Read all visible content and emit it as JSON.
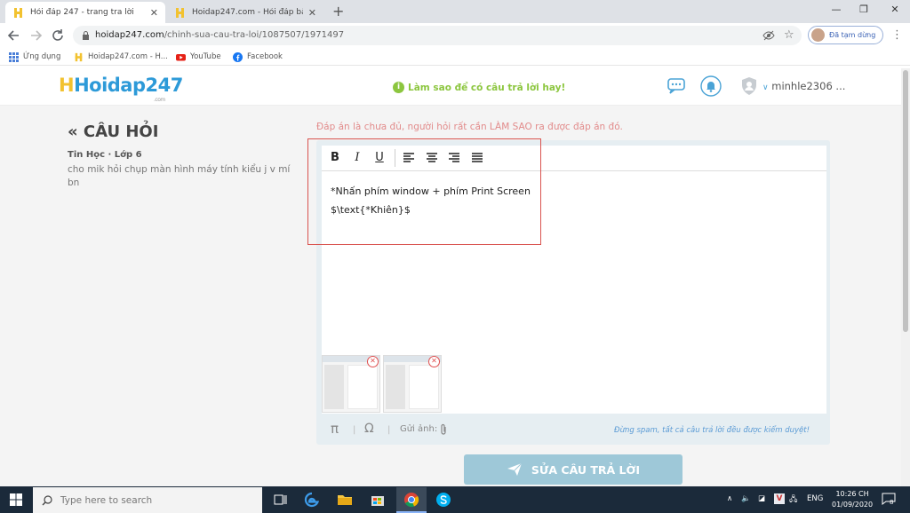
{
  "browser": {
    "tabs": [
      {
        "title": "Hỏi đáp 247 - trang tra lời",
        "active": true
      },
      {
        "title": "Hoidap247.com - Hỏi đáp bài tậ",
        "active": false
      }
    ],
    "new_tab": "+",
    "window_controls": [
      "—",
      "❐",
      "✕"
    ],
    "url_domain": "hoidap247.com",
    "url_path": "/chinh-sua-cau-tra-loi/1087507/1971497",
    "profile_status": "Đã tạm dừng",
    "bookmarks": [
      {
        "label": "Ứng dụng"
      },
      {
        "label": "Hoidap247.com - H..."
      },
      {
        "label": "YouTube"
      },
      {
        "label": "Facebook"
      }
    ]
  },
  "site": {
    "logo": "Hoidap247",
    "logo_suffix": ".com",
    "howto": "Làm sao để có câu trả lời hay!",
    "howto_icon": "i",
    "username": "minhle2306 ..."
  },
  "question": {
    "back_title": "« CÂU HỎI",
    "subject": "Tin Học · Lớp 6",
    "text": "cho mik hỏi chụp màn hình máy tính kiểu j v mí bn"
  },
  "editor": {
    "hint": "Đáp án là chưa đủ, người hỏi rất cần LÀM SAO ra được đáp án đó.",
    "format_buttons": [
      "B",
      "I",
      "U"
    ],
    "line1": "*Nhấn phím window + phím Print Screen",
    "line2": "$\\text{*Khiên}$",
    "thumb_remove": "✕",
    "toolbar_pi": "π",
    "toolbar_omega": "Ω",
    "toolbar_sep": "|",
    "send_image": "Gửi ảnh:",
    "spam_notice": "Đừng spam, tất cả câu trả lời đều được kiểm duyệt!"
  },
  "submit": {
    "label": "SỬA CÂU TRẢ LỜI"
  },
  "taskbar": {
    "search_placeholder": "Type here to search",
    "lang": "ENG",
    "time": "10:26 CH",
    "date": "01/09/2020",
    "notifications": "8"
  },
  "colors": {
    "accent_green": "#8cc63f",
    "logo_blue": "#2d9ad8",
    "submit_bg": "#9ec8d8",
    "highlight_red": "#d9534f"
  }
}
